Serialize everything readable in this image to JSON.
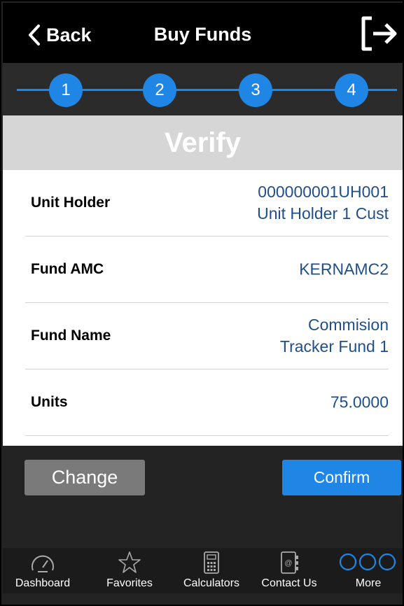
{
  "header": {
    "back_label": "Back",
    "title": "Buy Funds",
    "logout_icon": "logout-icon"
  },
  "stepper": {
    "steps": [
      "1",
      "2",
      "3",
      "4"
    ],
    "accent": "#1f86e6"
  },
  "section_title": "Verify",
  "details": [
    {
      "label": "Unit Holder",
      "value_lines": [
        "000000001UH001",
        "Unit Holder 1 Cust"
      ]
    },
    {
      "label": "Fund AMC",
      "value_lines": [
        "KERNAMC2"
      ]
    },
    {
      "label": "Fund Name",
      "value_lines": [
        "Commision",
        "Tracker Fund 1"
      ]
    },
    {
      "label": "Units",
      "value_lines": [
        "75.0000"
      ]
    }
  ],
  "actions": {
    "change_label": "Change",
    "confirm_label": "Confirm"
  },
  "tabbar": {
    "tabs": [
      {
        "label": "Dashboard",
        "icon": "speedometer-icon"
      },
      {
        "label": "Favorites",
        "icon": "star-icon"
      },
      {
        "label": "Calculators",
        "icon": "calculator-icon"
      },
      {
        "label": "Contact Us",
        "icon": "address-book-icon"
      },
      {
        "label": "More",
        "icon": "more-icon"
      }
    ],
    "active_color": "#1f86e6"
  }
}
